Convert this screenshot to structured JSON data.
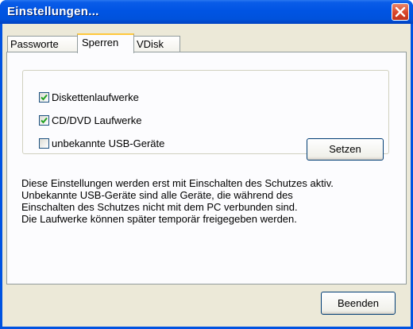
{
  "window": {
    "title": "Einstellungen..."
  },
  "tabs": [
    {
      "label": "Passworte",
      "active": false
    },
    {
      "label": "Sperren",
      "active": true
    },
    {
      "label": "VDisk",
      "active": false
    }
  ],
  "sperren": {
    "options": [
      {
        "label": "Diskettenlaufwerke",
        "checked": true
      },
      {
        "label": "CD/DVD Laufwerke",
        "checked": true
      },
      {
        "label": "unbekannte USB-Geräte",
        "checked": false
      }
    ],
    "set_button": "Setzen",
    "info_lines": [
      "Diese Einstellungen werden erst mit Einschalten des Schutzes aktiv.",
      "Unbekannte USB-Geräte sind alle Geräte, die während des",
      "Einschalten des Schutzes nicht mit dem PC verbunden sind.",
      "Die Laufwerke können später temporär freigegeben werden."
    ]
  },
  "footer": {
    "close_button": "Beenden"
  },
  "icons": {
    "close": "close-icon",
    "check": "checkmark-icon"
  },
  "colors": {
    "title_bar": "#0054e3",
    "window_bg": "#ece9d8",
    "tab_highlight": "#ffc83c",
    "check": "#21a121",
    "close_button": "#d9452a"
  }
}
